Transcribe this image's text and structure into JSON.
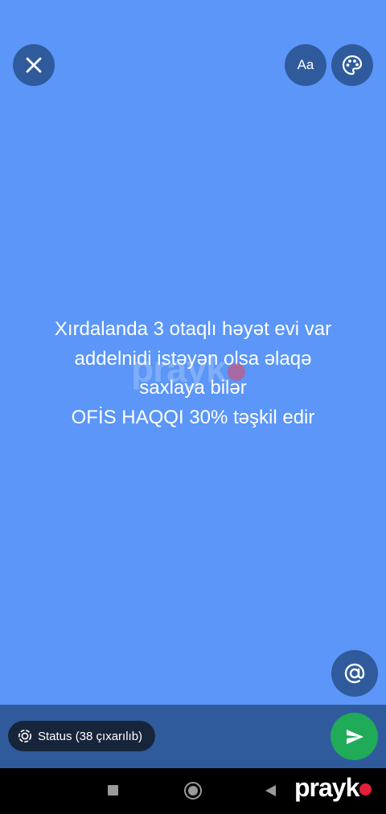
{
  "top_bar": {
    "font_label": "Aa"
  },
  "status_text": {
    "lines": [
      "Xırdalanda 3 otaqlı həyət evi var",
      "addelnidi istəyən olsa əlaqə",
      "saxlaya bilər",
      "OFİS HAQQI 30% təşkil edir"
    ]
  },
  "bottom_bar": {
    "status_chip_label": "Status (38 çıxarılıb)"
  },
  "watermark": {
    "text": "prayk"
  },
  "colors": {
    "background": "#5b96f8",
    "button": "#2f5b9c",
    "send": "#1fab57",
    "chip": "#17253a"
  },
  "icons": {
    "close": "close-icon",
    "palette": "palette-icon",
    "mention": "at-sign-icon",
    "status": "status-ring-icon",
    "send": "send-icon"
  }
}
